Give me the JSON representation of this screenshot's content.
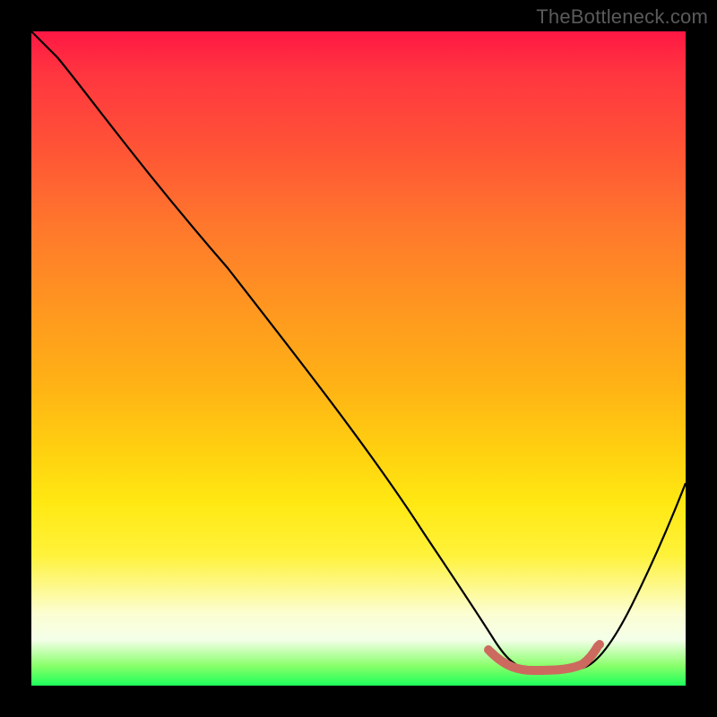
{
  "watermark": "TheBottleneck.com",
  "chart_data": {
    "type": "line",
    "title": "",
    "xlabel": "",
    "ylabel": "",
    "xlim": [
      0,
      100
    ],
    "ylim": [
      0,
      100
    ],
    "grid": false,
    "series": [
      {
        "name": "bottleneck-curve",
        "x": [
          0,
          4,
          10,
          20,
          30,
          40,
          50,
          58,
          62,
          66,
          70,
          74,
          78,
          82,
          86,
          90,
          94,
          100
        ],
        "y": [
          100,
          96,
          90,
          77,
          63,
          49,
          35,
          22,
          15,
          9,
          5,
          2.5,
          2.5,
          2.5,
          5,
          10,
          17,
          31
        ]
      }
    ],
    "highlight": {
      "name": "trough-band",
      "color": "#cc6a5f",
      "x_range": [
        70,
        86
      ],
      "y": 2.5
    },
    "gradient_stops": [
      {
        "pos": 0.0,
        "color": "#ff1744"
      },
      {
        "pos": 0.18,
        "color": "#ff5436"
      },
      {
        "pos": 0.42,
        "color": "#ff9620"
      },
      {
        "pos": 0.64,
        "color": "#ffd010"
      },
      {
        "pos": 0.8,
        "color": "#fff23a"
      },
      {
        "pos": 0.93,
        "color": "#f4ffe9"
      },
      {
        "pos": 1.0,
        "color": "#1eff5a"
      }
    ]
  }
}
